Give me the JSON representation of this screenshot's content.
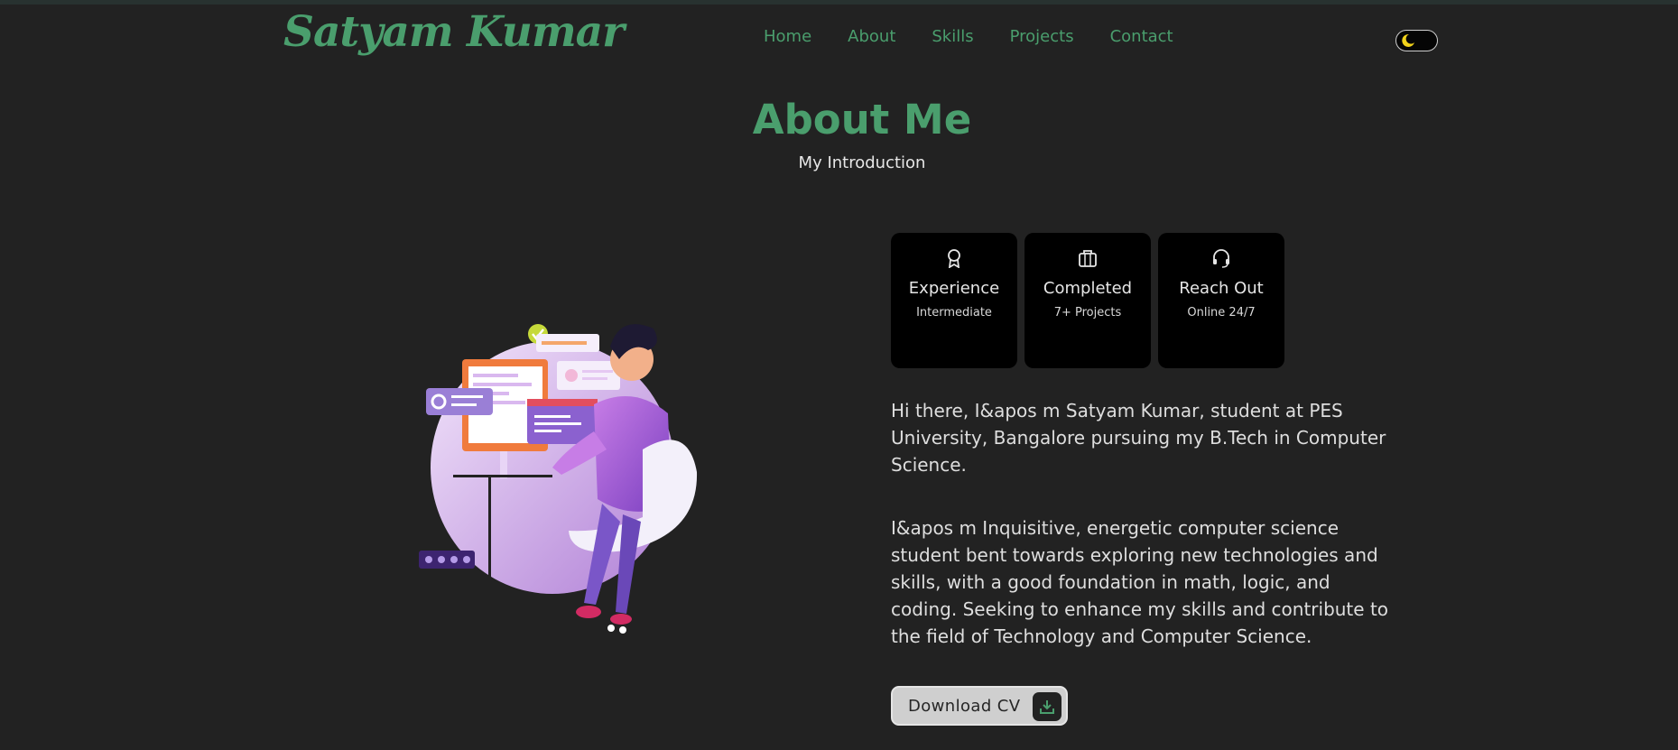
{
  "header": {
    "logo": "Satyam Kumar",
    "nav": [
      "Home",
      "About",
      "Skills",
      "Projects",
      "Contact"
    ],
    "theme_toggle_icon": "moon-icon"
  },
  "about": {
    "title": "About Me",
    "subtitle": "My Introduction",
    "cards": [
      {
        "title": "Experience",
        "sub": "Intermediate",
        "icon": "award-icon"
      },
      {
        "title": "Completed",
        "sub": "7+ Projects",
        "icon": "briefcase-icon"
      },
      {
        "title": "Reach Out",
        "sub": "Online 24/7",
        "icon": "headset-icon"
      }
    ],
    "paragraphs": [
      "Hi there, I&apos m Satyam Kumar, student at PES University, Bangalore pursuing my B.Tech in Computer Science.",
      "I&apos m Inquisitive, energetic computer science student bent towards exploring new technologies and skills, with a good foundation in math, logic, and coding. Seeking to enhance my skills and contribute to the field of Technology and Computer Science."
    ],
    "cv_button": "Download CV",
    "cv_icon": "download-icon"
  },
  "colors": {
    "background": "#222222",
    "accent": "#4a9e6d",
    "card": "#000000",
    "text": "#dedede"
  }
}
